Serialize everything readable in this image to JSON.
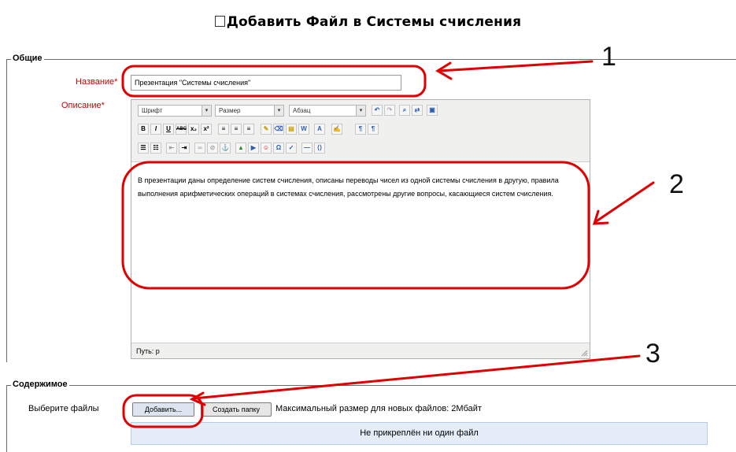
{
  "page": {
    "title": "Добавить Файл в Системы счисления",
    "title_icon": "checkbox-square-icon"
  },
  "general": {
    "legend": "Общие",
    "name_label": "Название",
    "name_value": "Презентация \"Системы счисления\"",
    "description_label": "Описание",
    "required_mark": "*"
  },
  "editor": {
    "font_select": "Шрифт",
    "size_select": "Размер",
    "paragraph_select": "Абзац",
    "toolbar_icons": {
      "row1": [
        "undo-icon",
        "redo-icon",
        "find-icon",
        "replace-icon",
        "fullscreen-icon"
      ],
      "row2": [
        "bold-icon",
        "italic-icon",
        "underline-icon",
        "strikethrough-icon",
        "subscript-icon",
        "superscript-icon",
        "align-left-icon",
        "align-center-icon",
        "align-right-icon",
        "cleanup-icon",
        "remove-format-icon",
        "paste-text-icon",
        "paste-word-icon",
        "text-color-icon",
        "highlight-color-icon",
        "ltr-icon",
        "rtl-icon"
      ],
      "row3": [
        "bullet-list-icon",
        "numbered-list-icon",
        "outdent-icon",
        "indent-icon",
        "link-icon",
        "unlink-icon",
        "anchor-icon",
        "image-icon",
        "media-icon",
        "emoticon-icon",
        "special-char-icon",
        "spellcheck-icon",
        "nonbreaking-icon",
        "html-source-icon"
      ]
    },
    "content": "В презентации даны определение систем счисления, описаны переводы чисел из одной системы счисления в другую, правила выполнения арифметических операций в системах счисления, рассмотрены другие вопросы, касающиеся систем счисления.",
    "path_label": "Путь: p"
  },
  "content_section": {
    "legend": "Содержимое",
    "choose_files_label": "Выберите файлы",
    "add_button": "Добавить...",
    "create_folder_button": "Создать папку",
    "max_size_text": "Максимальный размер для новых файлов: 2Мбайт",
    "no_file_text": "Не прикреплён ни один файл"
  },
  "annotations": {
    "markers": [
      "1",
      "2",
      "3"
    ],
    "highlight_color": "#e00000",
    "arrow_color": "#e00000"
  }
}
